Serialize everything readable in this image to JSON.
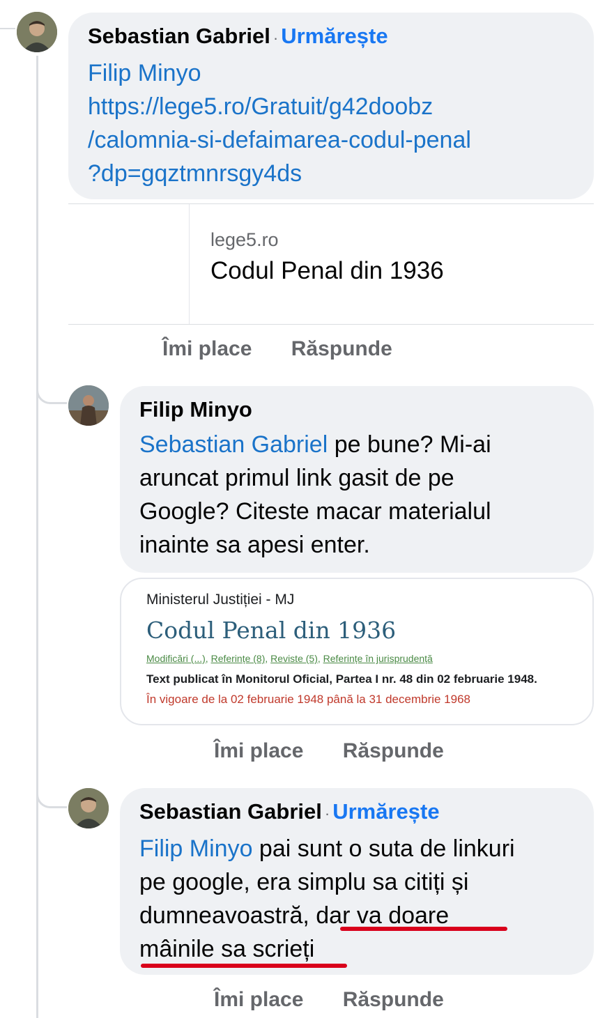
{
  "comments": [
    {
      "author": "Sebastian Gabriel",
      "separator": "·",
      "follow_label": "Urmărește",
      "mention": "Filip Minyo",
      "link_lines": [
        "https://lege5.ro/Gratuit/g42doobz",
        "/calomnia-si-defaimarea-codul-penal",
        "?dp=gqztmnrsgy4ds"
      ],
      "preview": {
        "domain": "lege5.ro",
        "title": "Codul Penal din 1936"
      },
      "like_label": "Îmi place",
      "reply_label": "Răspunde"
    },
    {
      "author": "Filip Minyo",
      "mention": "Sebastian Gabriel",
      "text_first": " pe bune? Mi-ai",
      "text_lines": [
        "aruncat primul link gasit de pe",
        "Google? Citeste macar materialul",
        "inainte sa apesi enter."
      ],
      "preview": {
        "source": "Ministerul Justiției - MJ",
        "title": "Codul Penal din 1936",
        "links": [
          "Modificări (...)",
          "Referințe (8)",
          "Reviste (5)",
          "Referințe în jurisprudență"
        ],
        "published": "Text publicat în Monitorul Oficial, Partea I nr. 48 din 02 februarie 1948.",
        "validity": "În vigoare de la 02 februarie 1948 până la 31 decembrie 1968"
      },
      "like_label": "Îmi place",
      "reply_label": "Răspunde"
    },
    {
      "author": "Sebastian Gabriel",
      "separator": "·",
      "follow_label": "Urmărește",
      "mention": "Filip Minyo",
      "text_first": " pai sunt o suta de linkuri",
      "text_line2": "pe google, era simplu sa citiți și",
      "text_line3_a": "dumneavoastră, ",
      "text_line3_b": "dar va doare",
      "text_line4": "mâinile sa scrieți",
      "like_label": "Îmi place",
      "reply_label": "Răspunde"
    }
  ],
  "colors": {
    "bubble": "#eff1f4",
    "mention": "#1a73c9",
    "follow": "#1877f2",
    "action": "#65676b",
    "highlight_underline": "#d9001b"
  },
  "icons": [
    "avatar-sebastian",
    "avatar-filip"
  ]
}
